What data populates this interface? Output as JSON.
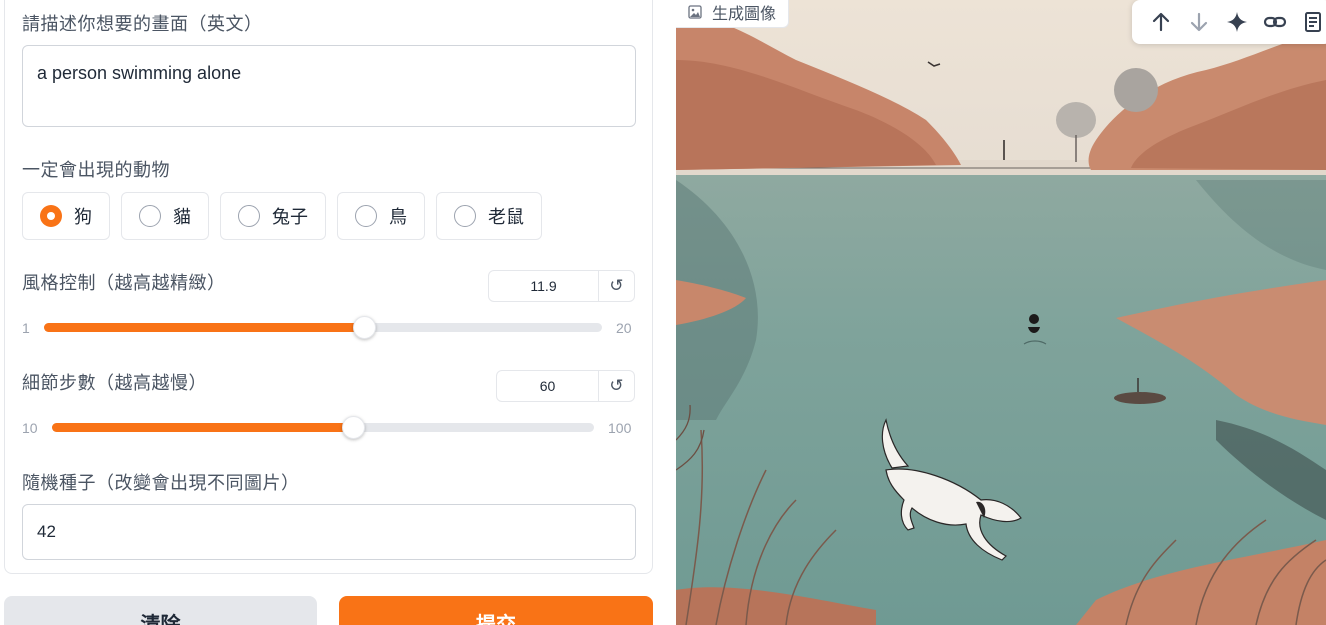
{
  "form": {
    "prompt_label": "請描述你想要的畫面（英文）",
    "prompt_value": "a person swimming alone",
    "animal_label": "一定會出現的動物",
    "animals": [
      {
        "label": "狗",
        "checked": true
      },
      {
        "label": "貓",
        "checked": false
      },
      {
        "label": "兔子",
        "checked": false
      },
      {
        "label": "鳥",
        "checked": false
      },
      {
        "label": "老鼠",
        "checked": false
      }
    ],
    "style_label": "風格控制（越高越精緻）",
    "style_value": "11.9",
    "style_min": "1",
    "style_max": "20",
    "steps_label": "細節步數（越高越慢）",
    "steps_value": "60",
    "steps_min": "10",
    "steps_max": "100",
    "seed_label": "隨機種子（改變會出現不同圖片）",
    "seed_value": "42",
    "reset_icon": "↺"
  },
  "actions": {
    "clear_label": "清除",
    "submit_label": "提交"
  },
  "output": {
    "label": "生成圖像",
    "toolbar_icons": [
      "arrow-up-icon",
      "arrow-down-icon",
      "sparkle-icon",
      "link-icon",
      "document-icon"
    ]
  },
  "colors": {
    "accent": "#f97316",
    "track": "#e5e7eb"
  }
}
